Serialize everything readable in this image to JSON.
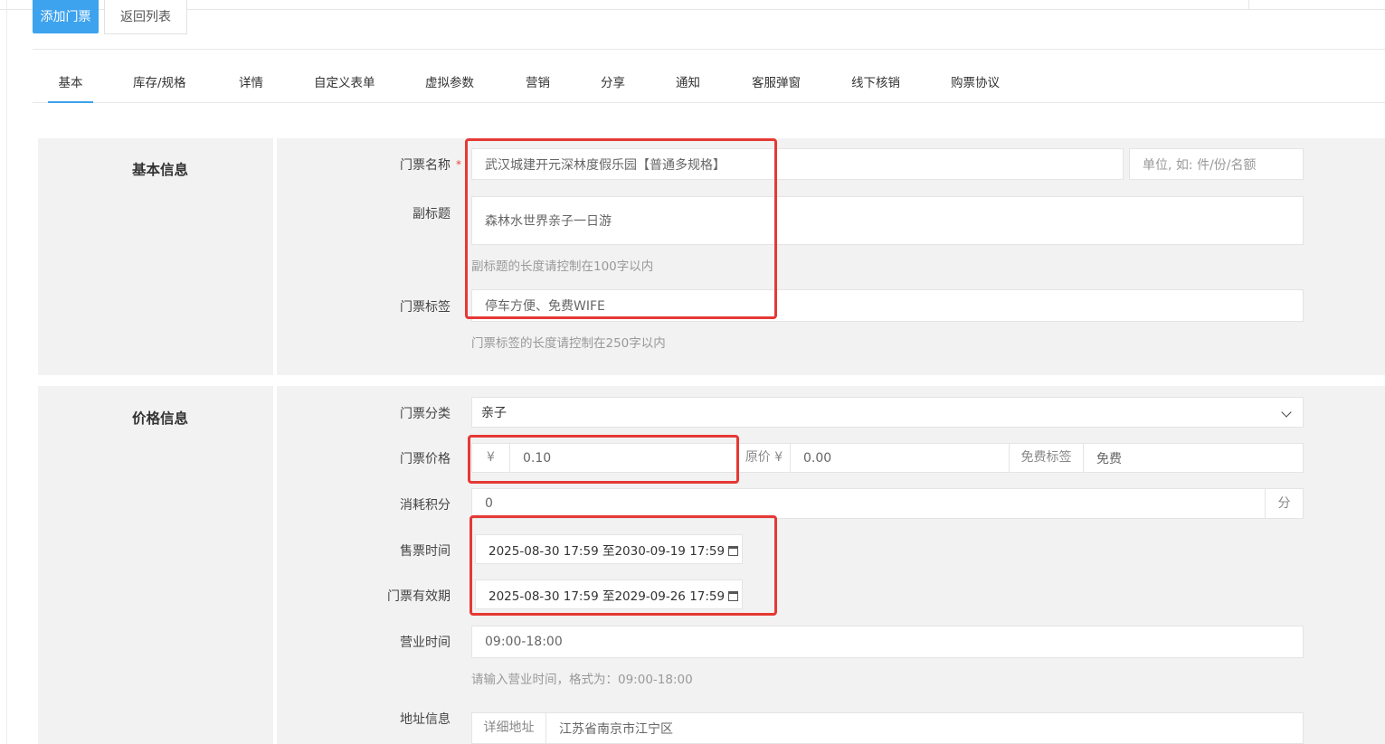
{
  "toolbar": {
    "add_label": "添加门票",
    "back_label": "返回列表"
  },
  "tabs": [
    "基本",
    "库存/规格",
    "详情",
    "自定义表单",
    "虚拟参数",
    "营销",
    "分享",
    "通知",
    "客服弹窗",
    "线下核销",
    "购票协议"
  ],
  "basic": {
    "title": "基本信息",
    "name_label": "门票名称",
    "name_value": "武汉城建开元深林度假乐园【普通多规格】",
    "unit_placeholder": "单位, 如: 件/份/名额",
    "subtitle_label": "副标题",
    "subtitle_value": "森林水世界亲子一日游",
    "subtitle_hint": "副标题的长度请控制在100字以内",
    "tags_label": "门票标签",
    "tags_value": "停车方便、免费WIFE",
    "tags_hint": "门票标签的长度请控制在250字以内"
  },
  "price": {
    "title": "价格信息",
    "category_label": "门票分类",
    "category_value": "亲子",
    "price_label": "门票价格",
    "currency": "¥",
    "price_value": "0.10",
    "orig_label": "原价 ¥",
    "orig_value": "0.00",
    "free_tag_label": "免费标签",
    "free_tag_value": "免费",
    "points_label": "消耗积分",
    "points_value": "0",
    "points_unit": "分",
    "sale_time_label": "售票时间",
    "sale_time_value": "2025-08-30 17:59 至2030-09-19 17:59",
    "valid_label": "门票有效期",
    "valid_value": "2025-08-30 17:59 至2029-09-26 17:59",
    "hours_label": "营业时间",
    "hours_value": "09:00-18:00",
    "hours_hint": "请输入营业时间，格式为：09:00-18:00",
    "addr_label": "地址信息",
    "addr_addon": "详细地址",
    "addr_value": "江苏省南京市江宁区"
  },
  "colors": {
    "accent": "#3ea3ee",
    "highlight": "#e53935"
  }
}
